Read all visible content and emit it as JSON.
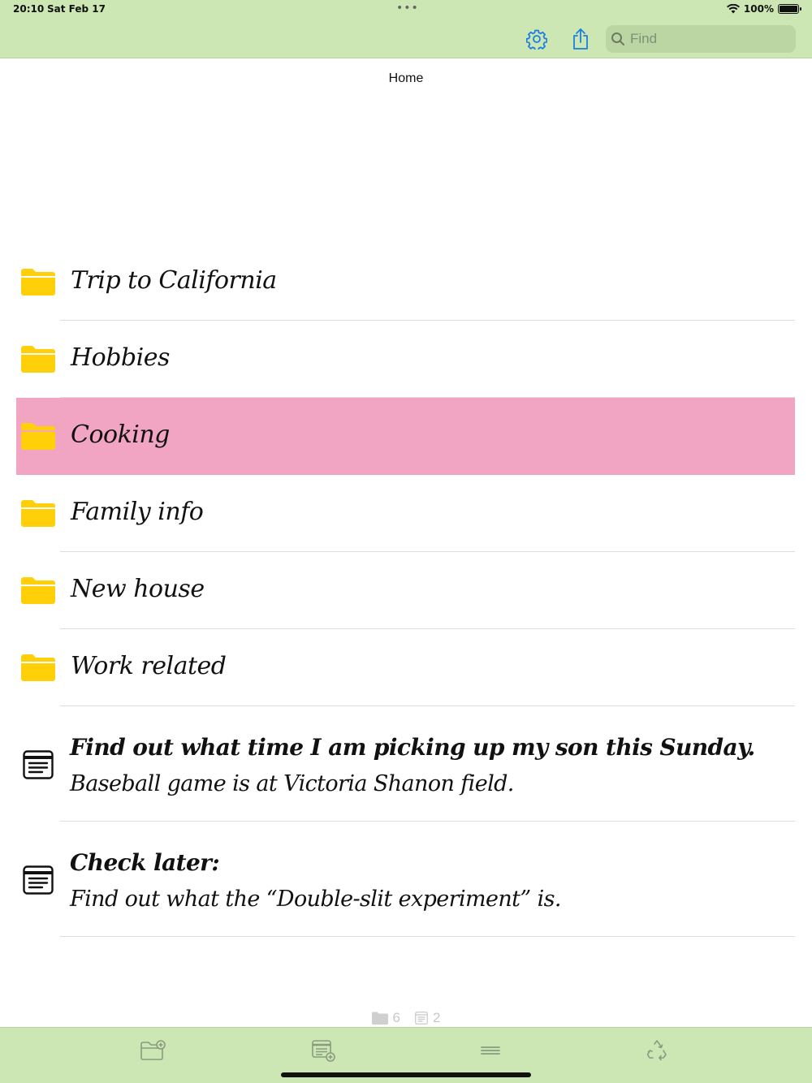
{
  "status": {
    "time": "20:10",
    "date": "Sat Feb 17",
    "battery": "100%"
  },
  "search": {
    "placeholder": "Find"
  },
  "page": {
    "title": "Home"
  },
  "folders": [
    {
      "name": "Trip to California"
    },
    {
      "name": "Hobbies"
    },
    {
      "name": "Cooking",
      "selected": true
    },
    {
      "name": "Family info"
    },
    {
      "name": "New house"
    },
    {
      "name": "Work related"
    }
  ],
  "notes": [
    {
      "title": "Find out what time I am picking up my son this Sunday.",
      "body": "Baseball game is at Victoria Shanon field."
    },
    {
      "title": "Check later:",
      "body": "Find out what the “Double-slit experiment” is."
    }
  ],
  "counts": {
    "folders": "6",
    "notes": "2"
  },
  "colors": {
    "bar": "#cde7b4",
    "accent": "#1a7fe0",
    "folder": "#ffcf0a",
    "selected": "#f2a5c2"
  },
  "icons": {
    "settings": "gear-icon",
    "share": "share-icon",
    "search": "search-icon",
    "new_folder": "folder-add-icon",
    "new_note": "note-add-icon",
    "menu": "menu-icon",
    "recycle": "recycle-icon"
  }
}
